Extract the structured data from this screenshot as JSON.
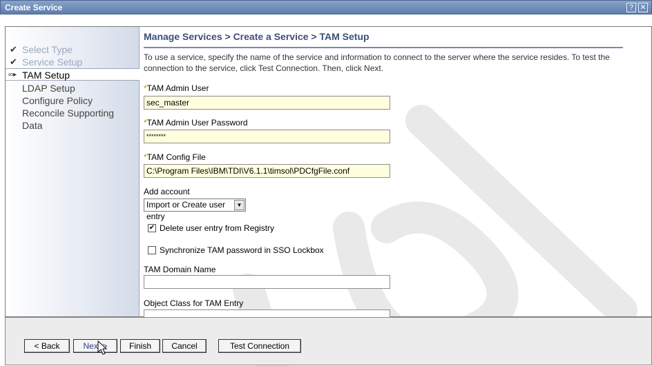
{
  "window": {
    "title": "Create Service",
    "help_label": "?",
    "close_label": "✕"
  },
  "nav": {
    "items": [
      {
        "label": "Select Type",
        "state": "done",
        "mark": "✔"
      },
      {
        "label": "Service Setup",
        "state": "done",
        "mark": "✔"
      },
      {
        "label": "TAM Setup",
        "state": "current",
        "mark": "∞▸"
      },
      {
        "label": "LDAP Setup",
        "state": "pending",
        "mark": ""
      },
      {
        "label": "Configure Policy",
        "state": "pending",
        "mark": ""
      },
      {
        "label": "Reconcile Supporting",
        "state": "pending",
        "mark": ""
      },
      {
        "label": "Data",
        "state": "pending",
        "mark": ""
      }
    ]
  },
  "main": {
    "breadcrumb": "Manage Services > Create a Service > TAM Setup",
    "description": "To use a service, specify the name of the service and information to connect to the server where the service resides. To test the connection to the service, click Test Connection. Then, click Next.",
    "required_mark": "*",
    "admin_user_label": "TAM Admin User",
    "admin_user_value": "sec_master",
    "admin_password_label": "TAM Admin User Password",
    "admin_password_value": "********",
    "config_file_label": "TAM Config File",
    "config_file_value": "C:\\Program Files\\IBM\\TDI\\V6.1.1\\timsol\\PDCfgFile.conf",
    "add_account_label": "Add account",
    "add_account_value": "Import or Create user entry",
    "delete_entry_label": "Delete user entry from Registry",
    "delete_entry_checked": true,
    "sync_password_label": "Synchronize TAM password in SSO Lockbox",
    "sync_password_checked": false,
    "domain_name_label": "TAM Domain Name",
    "domain_name_value": "",
    "object_class_label": "Object Class for TAM Entry",
    "object_class_value": ""
  },
  "footer": {
    "back_label": "< Back",
    "next_label": "Next >",
    "finish_label": "Finish",
    "cancel_label": "Cancel",
    "test_label": "Test Connection"
  },
  "colors": {
    "titlebar": "#5c7dad",
    "required_field": "#ffffe0",
    "breadcrumb": "#3a4f7a",
    "required_mark": "#c98a00"
  }
}
